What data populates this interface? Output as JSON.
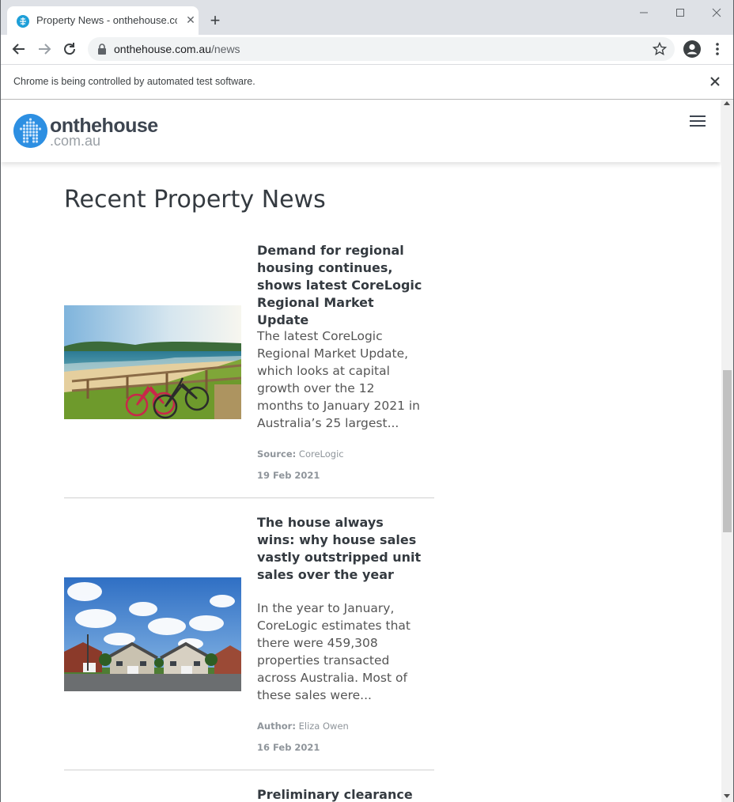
{
  "browser": {
    "tab_title": "Property News - onthehouse.com.au",
    "url_host": "onthehouse.com.au",
    "url_path": "/news",
    "infobar_text": "Chrome is being controlled by automated test software."
  },
  "site": {
    "logo_word": "onthehouse",
    "logo_sub": ".com.au",
    "page_title": "Recent Property News"
  },
  "articles": [
    {
      "title": "Demand for regional housing continues, shows latest CoreLogic Regional Market Update",
      "excerpt": "The latest CoreLogic Regional Market Update, which looks at capital growth over the 12 months to January 2021 in Australia’s 25 largest...",
      "meta_label": "Source:",
      "meta_value": "CoreLogic",
      "date": "19 Feb 2021"
    },
    {
      "title": "The house always wins: why house sales vastly outstripped unit sales over the year",
      "excerpt": "In the year to January, CoreLogic estimates that there were 459,308 properties transacted across Australia. Most of these sales were...",
      "meta_label": "Author:",
      "meta_value": "Eliza Owen",
      "date": "16 Feb 2021"
    },
    {
      "title": "Preliminary clearance"
    }
  ],
  "colors": {
    "brand_blue": "#2d8fe2",
    "heading": "#343a40",
    "meta": "#8f959b"
  }
}
